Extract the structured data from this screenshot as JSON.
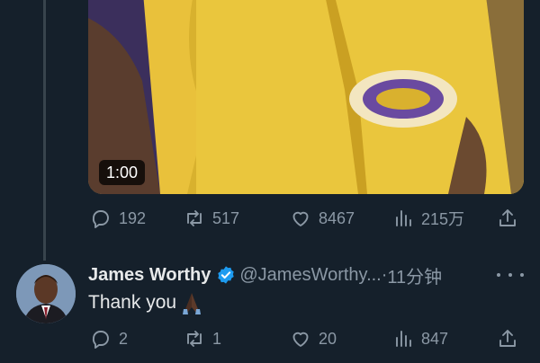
{
  "video": {
    "duration": "1:00"
  },
  "original_tweet_stats": {
    "replies": "192",
    "retweets": "517",
    "likes": "8467",
    "views": "215万"
  },
  "reply_tweet": {
    "display_name": "James Worthy",
    "handle": "@JamesWorthy...",
    "separator": " · ",
    "time_ago": "11分钟",
    "text": "Thank you",
    "emoji": "🙏🏿",
    "stats": {
      "replies": "2",
      "retweets": "1",
      "likes": "20",
      "views": "847"
    }
  },
  "colors": {
    "background": "#15202b",
    "muted": "#8b98a5",
    "verified": "#1d9bf0"
  },
  "icons": [
    "reply-icon",
    "retweet-icon",
    "like-icon",
    "views-icon",
    "share-icon",
    "verified-badge-icon",
    "more-icon"
  ]
}
